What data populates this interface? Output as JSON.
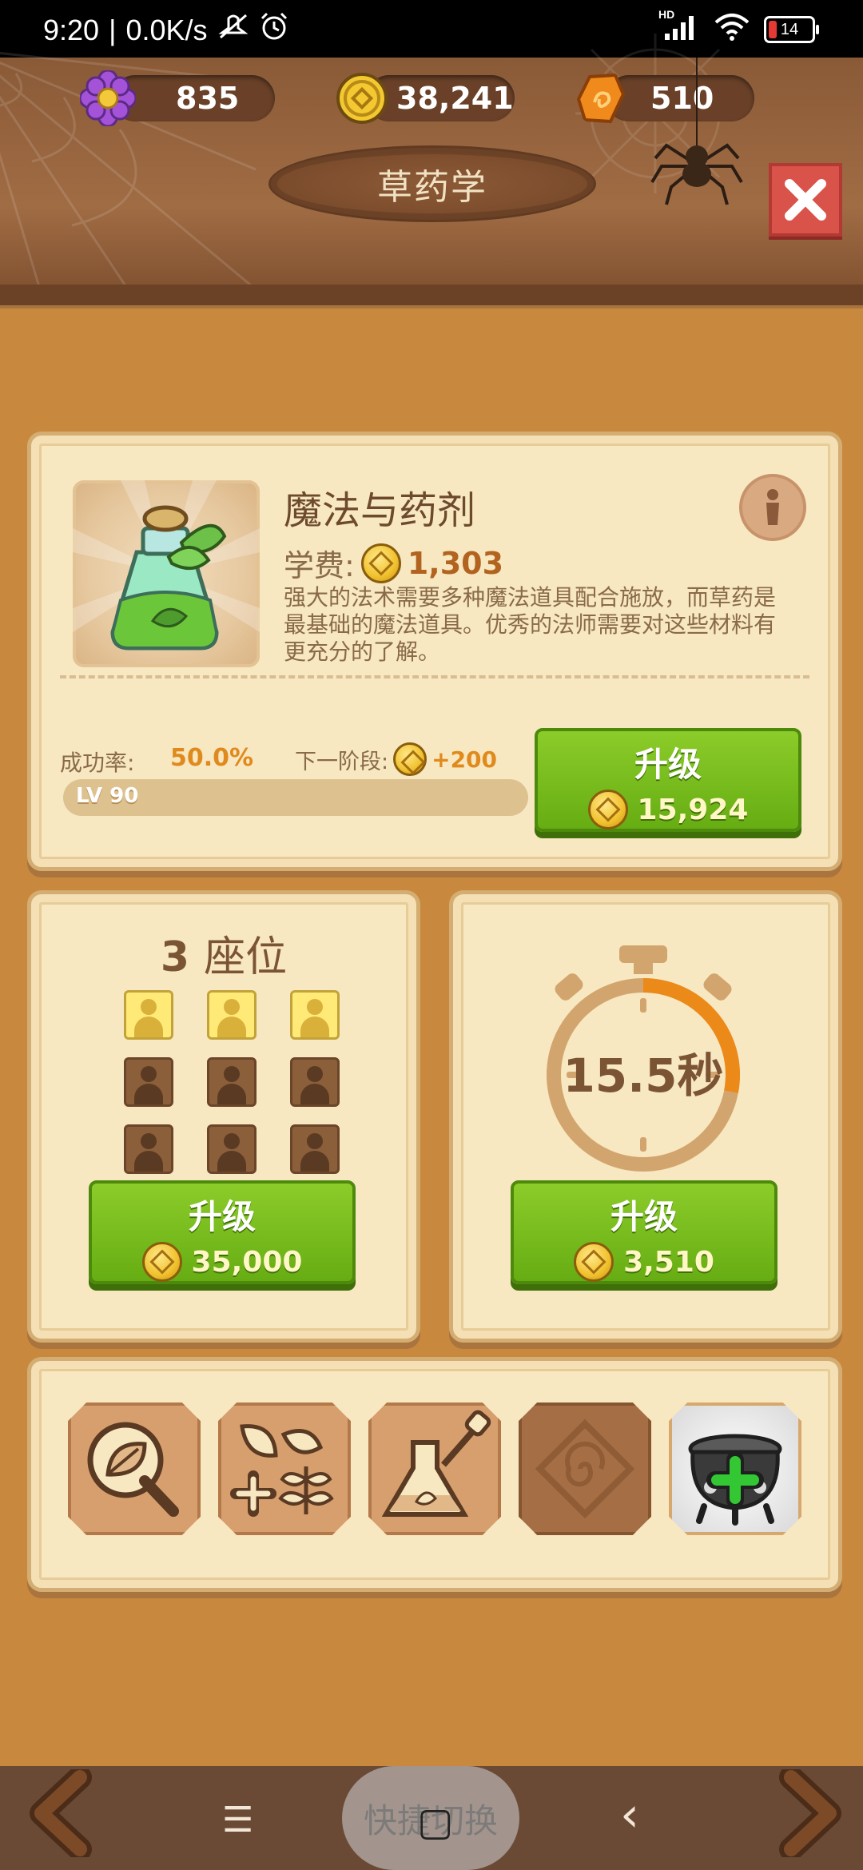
{
  "status_bar": {
    "time": "9:20",
    "separator": "|",
    "network_speed": "0.0K/s",
    "battery_level": "14",
    "hd_label": "HD"
  },
  "resources": {
    "gems": "835",
    "coins": "38,241",
    "shards": "510"
  },
  "header": {
    "title": "草药学"
  },
  "course": {
    "name": "魔法与药剂",
    "fee_label": "学费:",
    "fee_value": "1,303",
    "description": "强大的法术需要多种魔法道具配合施放，而草药是最基础的魔法道具。优秀的法师需要对这些材料有更充分的了解。",
    "success_rate_label": "成功率:",
    "success_rate_value": "50.0%",
    "next_stage_label": "下一阶段:",
    "next_stage_value": "+200",
    "level_text": "LV 90",
    "level_progress": 0,
    "upgrade_label": "升级",
    "upgrade_cost": "15,924"
  },
  "seats": {
    "count": "3",
    "label": "座位",
    "filled": 3,
    "total": 9,
    "upgrade_label": "升级",
    "upgrade_cost": "35,000"
  },
  "timer": {
    "value": "15.5秒",
    "progress": 0.28,
    "upgrade_label": "升级",
    "upgrade_cost": "3,510"
  },
  "tools": [
    {
      "name": "leaf-magnifier",
      "state": "available"
    },
    {
      "name": "herbs-plus",
      "state": "available"
    },
    {
      "name": "flask-dropper",
      "state": "available"
    },
    {
      "name": "locked-slot",
      "state": "locked"
    },
    {
      "name": "cauldron-plus",
      "state": "selected"
    }
  ],
  "nav": {
    "pill_label": "快捷切换",
    "menu_icon": "☰",
    "home_icon": "▢",
    "back_icon": "‹"
  },
  "colors": {
    "accent_green": "#74b81c",
    "coin_gold": "#f0c12d",
    "orange_text": "#e08a1d",
    "panel": "#f7e8c2"
  }
}
